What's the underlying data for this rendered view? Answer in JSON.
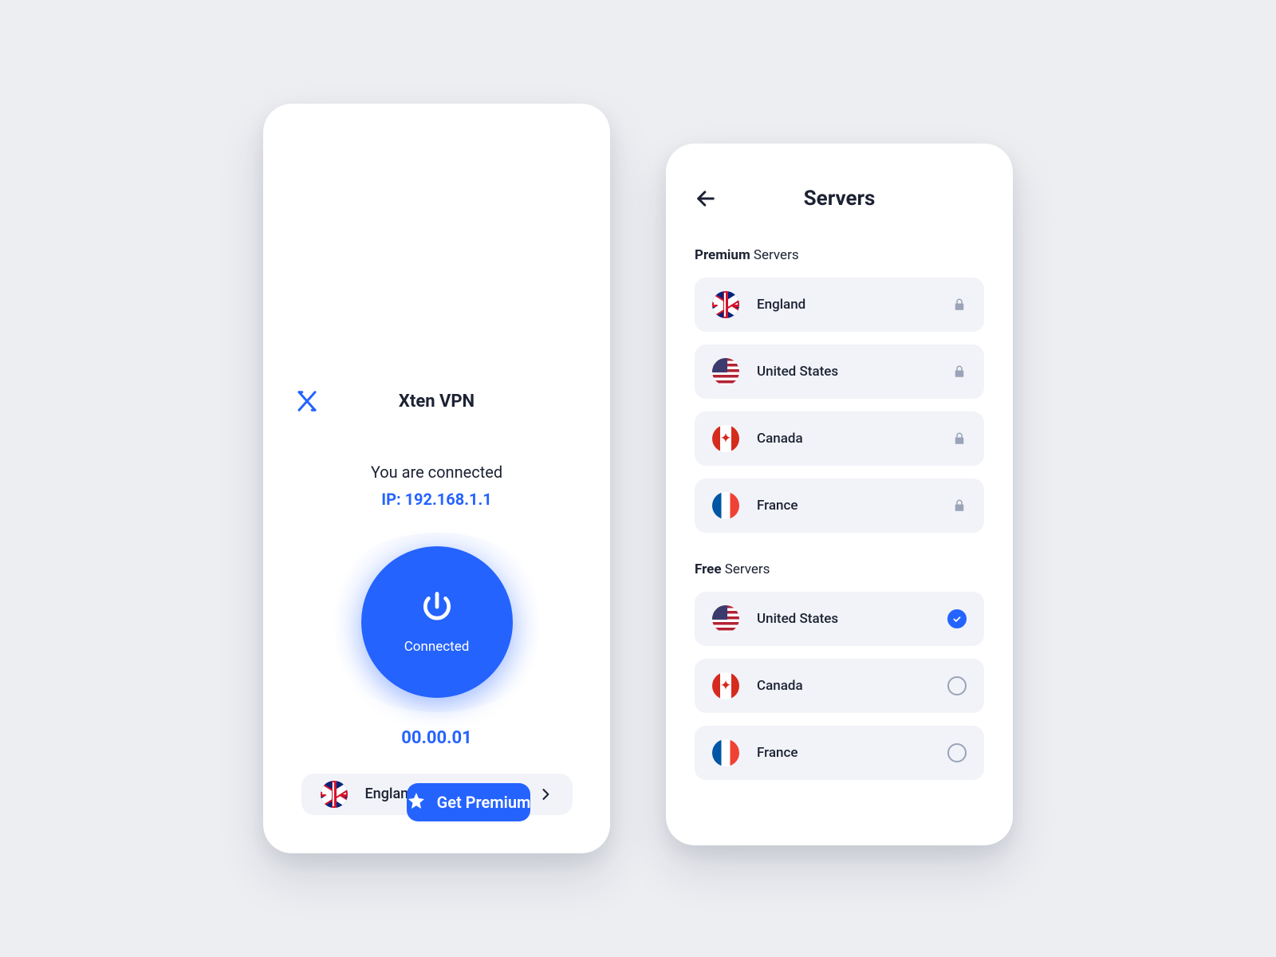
{
  "home": {
    "app_name": "Xten VPN",
    "status": "You are connected",
    "ip_label": "IP: 192.168.1.1",
    "dial_label": "Connected",
    "timer": "00.00.01",
    "current_server": "England",
    "premium_cta": "Get Premium"
  },
  "servers": {
    "title": "Servers",
    "premium_heading_bold": "Premium",
    "premium_heading_rest": "Servers",
    "free_heading_bold": "Free",
    "free_heading_rest": "Servers",
    "premium": [
      {
        "name": "England",
        "flag": "uk",
        "locked": true
      },
      {
        "name": "United States",
        "flag": "us",
        "locked": true
      },
      {
        "name": "Canada",
        "flag": "ca",
        "locked": true
      },
      {
        "name": "France",
        "flag": "fr",
        "locked": true
      }
    ],
    "free": [
      {
        "name": "United States",
        "flag": "us",
        "selected": true
      },
      {
        "name": "Canada",
        "flag": "ca",
        "selected": false
      },
      {
        "name": "France",
        "flag": "fr",
        "selected": false
      }
    ]
  },
  "colors": {
    "accent": "#2563ff"
  }
}
